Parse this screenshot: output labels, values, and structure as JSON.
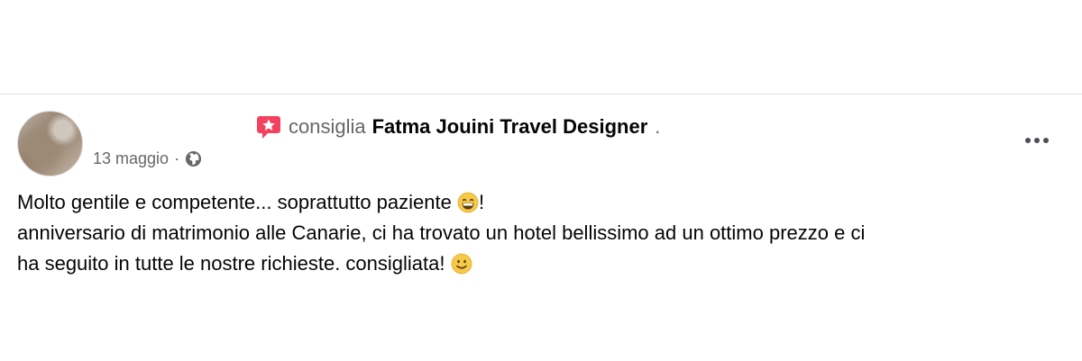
{
  "post": {
    "verb": "consiglia",
    "page_name": "Fatma Jouini Travel Designer",
    "trailing_dot": ".",
    "date": "13 maggio",
    "separator": "·",
    "privacy_icon": "globe-icon",
    "recommend_icon": "recommend-icon",
    "more_icon": "more-options-icon",
    "text": {
      "line1": "Molto gentile e competente... soprattutto paziente",
      "line1_end": "!",
      "line2": "anniversario di matrimonio alle Canarie, ci ha trovato un hotel bellissimo ad un ottimo prezzo e ci",
      "line3": "ha seguito in tutte le nostre richieste. consigliata!",
      "emoji1": "grinning-face-with-smiling-eyes",
      "emoji2": "slightly-smiling-face"
    }
  },
  "colors": {
    "recommend_accent": "#f3425f",
    "meta_gray": "#65676b",
    "text": "#050505",
    "emoji_yellow": "#f7c948"
  }
}
